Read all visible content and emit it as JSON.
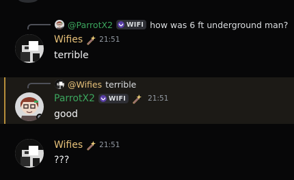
{
  "colors": {
    "background": "#070708",
    "highlight_bg": "#1c1a16",
    "highlight_bar": "#b8903a",
    "wifies_name": "#e8c27a",
    "parrot_name": "#3ba55d",
    "text": "#f2f3f5",
    "muted": "#949ba4"
  },
  "messages": [
    {
      "reply": {
        "author": "@ParrotX2",
        "tag": "WIFI",
        "text": "how was 6 ft underground man?"
      },
      "author": "Wifies",
      "time": "21:51",
      "content": "terrible",
      "role_icon": "magic-wand-icon"
    },
    {
      "reply": {
        "author": "@Wifies",
        "text": "terrible"
      },
      "author": "ParrotX2",
      "tag": "WIFI",
      "time": "21:51",
      "content": "good",
      "role_icon": "magic-wand-icon"
    },
    {
      "author": "Wifies",
      "time": "21:51",
      "content": "???",
      "role_icon": "magic-wand-icon"
    }
  ]
}
